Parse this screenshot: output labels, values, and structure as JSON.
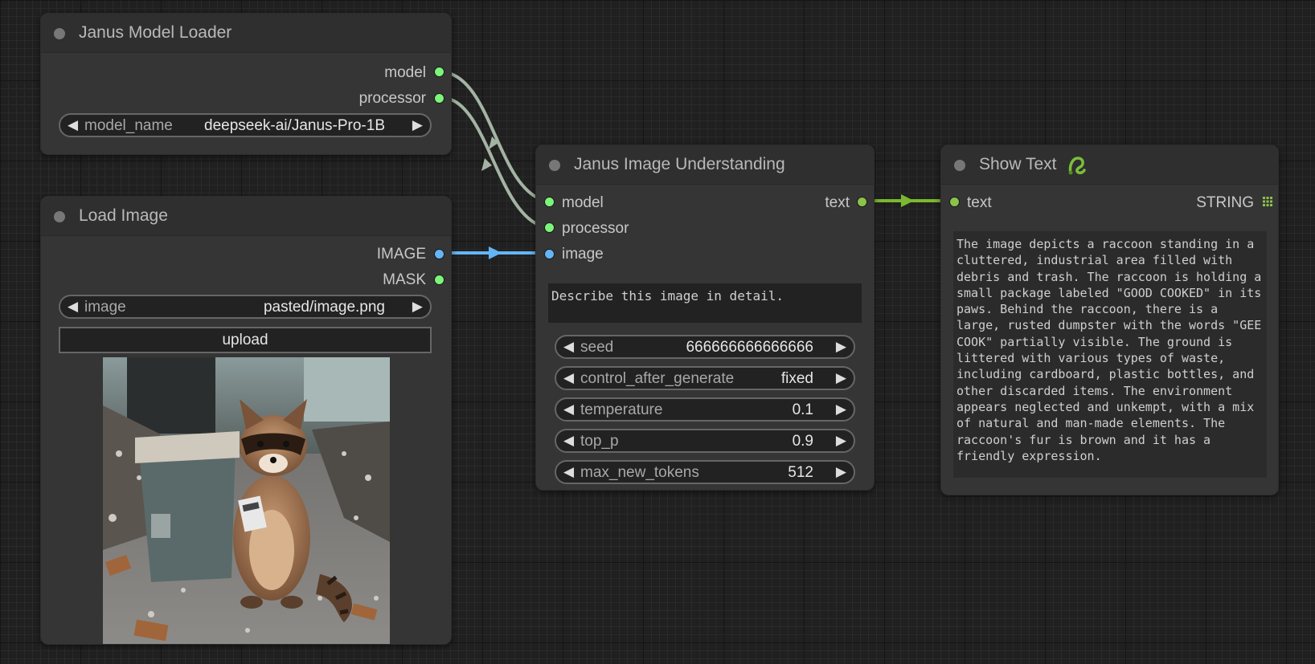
{
  "nodes": {
    "model_loader": {
      "title": "Janus Model Loader",
      "outputs": [
        "model",
        "processor"
      ],
      "widget": {
        "name": "model_name",
        "value": "deepseek-ai/Janus-Pro-1B"
      }
    },
    "load_image": {
      "title": "Load Image",
      "outputs": [
        "IMAGE",
        "MASK"
      ],
      "widget": {
        "name": "image",
        "value": "pasted/image.png"
      },
      "upload_label": "upload"
    },
    "understanding": {
      "title": "Janus Image Understanding",
      "inputs": [
        "model",
        "processor",
        "image"
      ],
      "output": "text",
      "prompt": "Describe this image in detail.",
      "widgets": [
        {
          "name": "seed",
          "value": "666666666666666"
        },
        {
          "name": "control_after_generate",
          "value": "fixed"
        },
        {
          "name": "temperature",
          "value": "0.1"
        },
        {
          "name": "top_p",
          "value": "0.9"
        },
        {
          "name": "max_new_tokens",
          "value": "512"
        }
      ]
    },
    "show_text": {
      "title": "Show Text",
      "input": "text",
      "output": "STRING",
      "text": "The image depicts a raccoon standing in a cluttered, industrial area filled with debris and trash. The raccoon is holding a small package labeled \"GOOD COOKED\" in its paws. Behind the raccoon, there is a large, rusted dumpster with the words \"GEE COOK\" partially visible. The ground is littered with various types of waste, including cardboard, plastic bottles, and other discarded items. The environment appears neglected and unkempt, with a mix of natural and man-made elements. The raccoon's fur is brown and it has a friendly expression."
    }
  },
  "colors": {
    "canvas": "#202020",
    "node_body": "#353535",
    "node_header": "#2f2f2f",
    "slot_model": "#7cf57a",
    "slot_image": "#64b5f6",
    "slot_string": "#8bc34a",
    "link_model": "#9aaa9a",
    "link_image": "#64b5f6",
    "link_string": "#7cb82f"
  },
  "icons": {
    "show_text_badge": "snake-logo-icon",
    "string_output": "grid-icon"
  }
}
